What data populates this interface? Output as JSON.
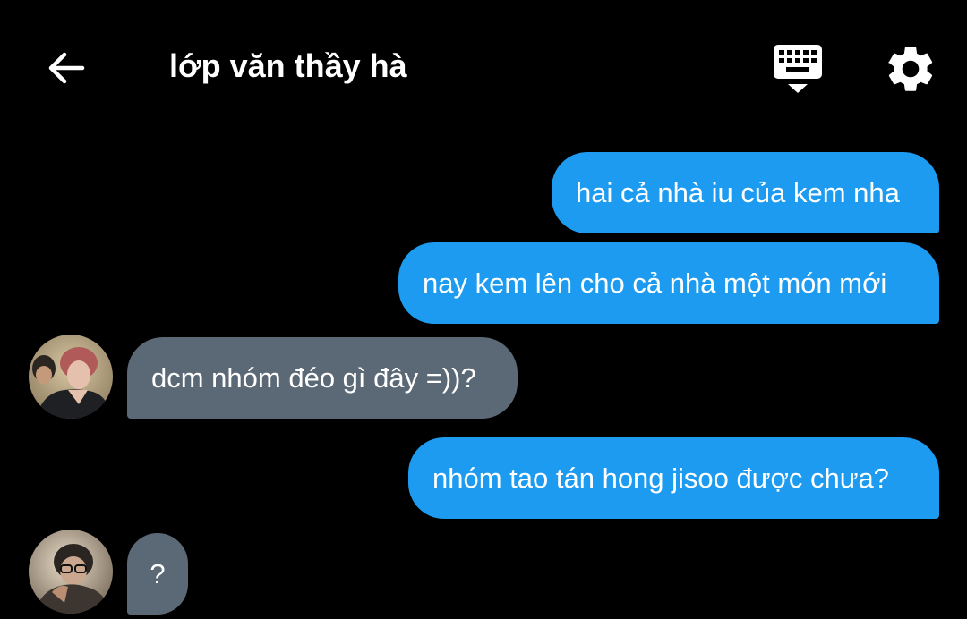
{
  "header": {
    "title": "lớp văn thầy hà",
    "back_icon": "arrow-left-icon",
    "keyboard_icon": "keyboard-hide-icon",
    "settings_icon": "gear-icon"
  },
  "messages": [
    {
      "side": "outgoing",
      "text": "hai cả nhà iu của kem nha"
    },
    {
      "side": "outgoing",
      "text": "nay kem lên cho cả nhà một món mới"
    },
    {
      "side": "incoming",
      "text": "dcm nhóm đéo gì đây =))?"
    },
    {
      "side": "outgoing",
      "text": "nhóm tao tán hong jisoo được chưa?"
    },
    {
      "side": "incoming",
      "text": "?"
    }
  ],
  "colors": {
    "background": "#000000",
    "outgoing_bubble": "#1d9bf0",
    "incoming_bubble": "#5b6876",
    "text": "#ffffff"
  }
}
